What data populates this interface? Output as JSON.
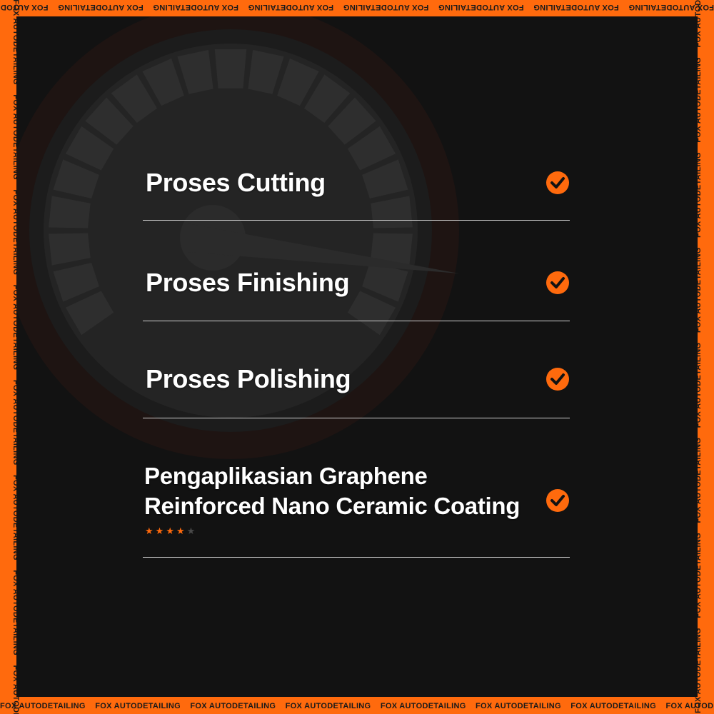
{
  "brand": {
    "border_text": "FOX AUTODETAILING",
    "accent_color": "#ff6a0d",
    "panel_color": "#121212"
  },
  "steps": [
    {
      "title": "Proses Cutting",
      "status_icon": "check-circle-icon"
    },
    {
      "title": "Proses Finishing",
      "status_icon": "check-circle-icon"
    },
    {
      "title": "Proses Polishing",
      "status_icon": "check-circle-icon"
    },
    {
      "title_line1": "Pengaplikasian Graphene",
      "title_line2": "Reinforced Nano Ceramic Coating",
      "status_icon": "check-circle-icon",
      "rating": 4,
      "rating_max": 5
    }
  ]
}
